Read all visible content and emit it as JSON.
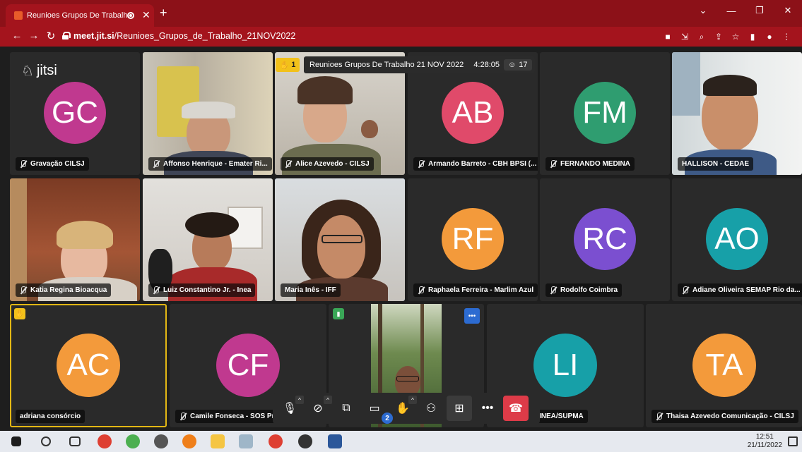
{
  "browser": {
    "tab_title": "Reunioes Grupos De Trabalh",
    "url_host": "meet.jit.si",
    "url_path": "/Reunioes_Grupos_de_Trabalho_21NOV2022"
  },
  "meeting": {
    "logo_text": "jitsi",
    "title": "Reunioes Grupos De Trabalho 21 NOV 2022",
    "duration": "4:28:05",
    "participant_count": "17",
    "raised_hands": "1",
    "chat_unread": "2"
  },
  "participants": [
    {
      "initials": "GC",
      "name": "Gravação CILSJ",
      "color": "#c0398f"
    },
    {
      "name": "Affonso Henrique - Emater Ri..."
    },
    {
      "name": "Alice Azevedo - CILSJ"
    },
    {
      "initials": "AB",
      "name": "Armando Barreto - CBH BPSI (...",
      "color": "#e04a6a"
    },
    {
      "initials": "FM",
      "name": "FERNANDO MEDINA",
      "color": "#2f9d70"
    },
    {
      "name": "HALLISON - CEDAE"
    },
    {
      "name": "Katia Regina Bioacqua"
    },
    {
      "name": "Luiz Constantino Jr. - Inea"
    },
    {
      "name": "Maria Inês - IFF"
    },
    {
      "initials": "RF",
      "name": "Raphaela Ferreira - Marlim Azul",
      "color": "#f39a3b"
    },
    {
      "initials": "RC",
      "name": "Rodolfo Coimbra",
      "color": "#7b4fd0"
    },
    {
      "initials": "AO",
      "name": "Adiane Oliveira SEMAP Rio da...",
      "color": "#17a0a8"
    },
    {
      "initials": "AC",
      "name": "adriana consórcio",
      "color": "#f39a3b"
    },
    {
      "initials": "CF",
      "name": "Camile Fonseca - SOS Pra",
      "color": "#c0398f"
    },
    {
      "initials": "LI",
      "name": "INEA/SUPMA",
      "color": "#17a0a8"
    },
    {
      "initials": "TA",
      "name": "Thaisa Azevedo Comunicação - CILSJ",
      "color": "#f39a3b"
    }
  ],
  "taskbar": {
    "time": "12:51",
    "date": "21/11/2022"
  }
}
